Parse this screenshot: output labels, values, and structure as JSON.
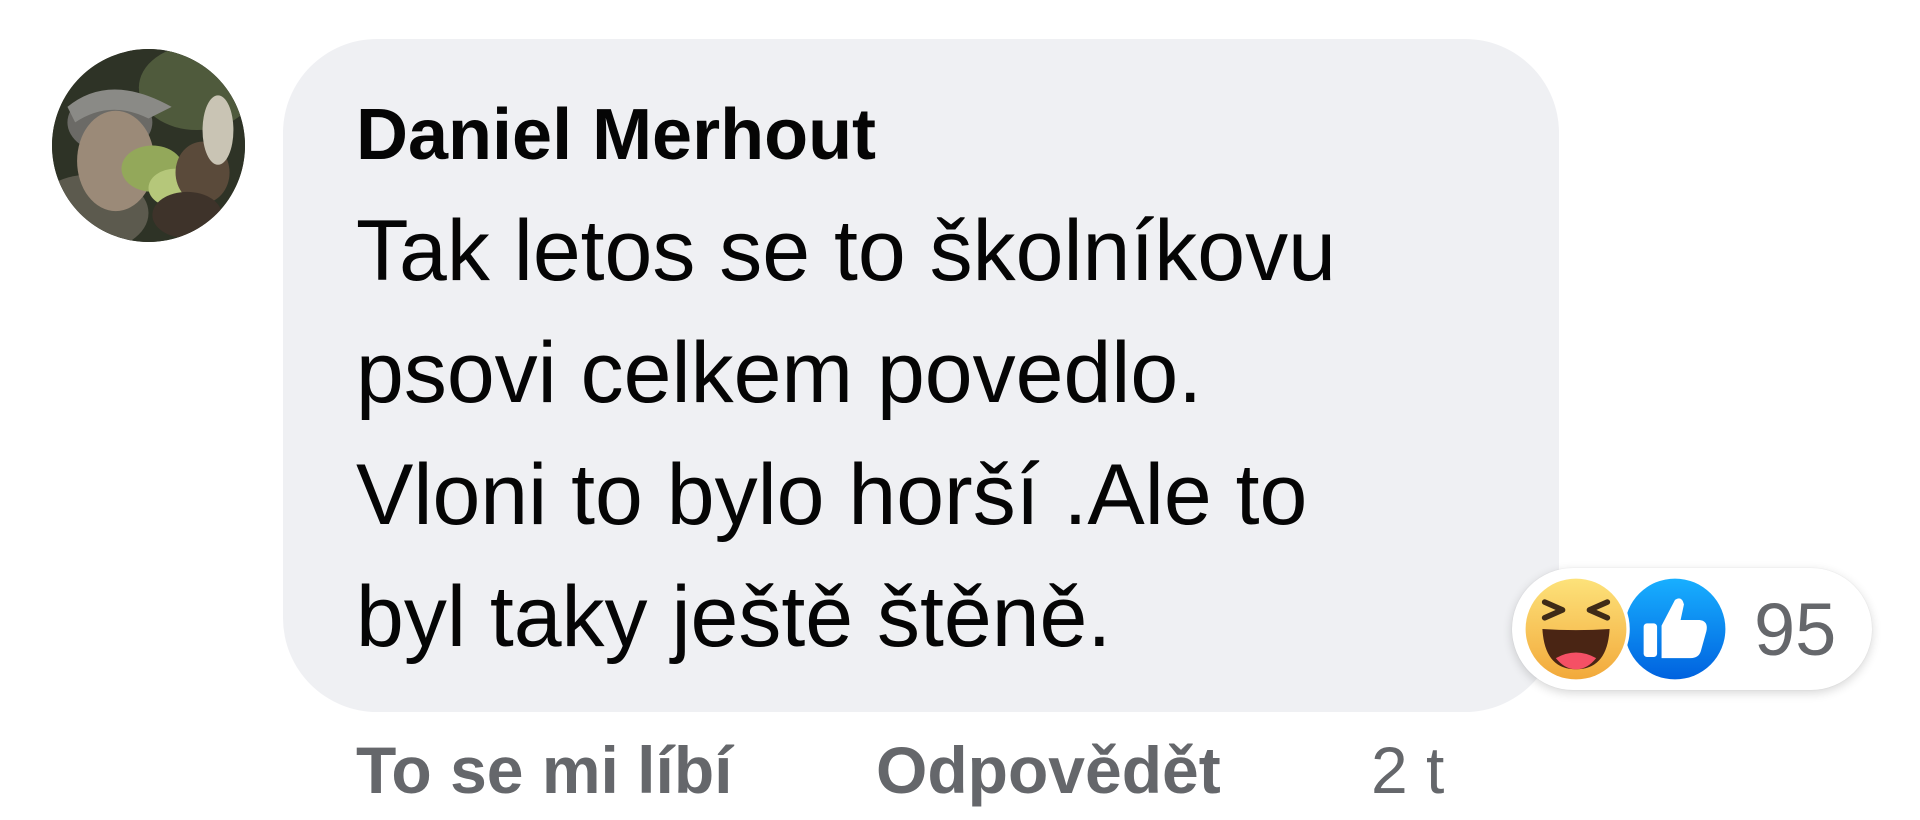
{
  "comment": {
    "author": "Daniel Merhout",
    "text_lines": [
      "Tak letos se to školníkovu",
      "psovi celkem povedlo.",
      "Vloni to bylo horší .Ale to",
      "byl taky ještě štěně."
    ],
    "reactions": {
      "icons": [
        "haha-emoji-icon",
        "like-thumb-icon"
      ],
      "count": "95"
    },
    "actions": {
      "like_label": "To se mi líbí",
      "reply_label": "Odpovědět",
      "timestamp": "2 t"
    }
  },
  "colors": {
    "bubble_background": "#eff0f3",
    "primary_text": "#050505",
    "secondary_text": "#65676b",
    "like_blue": "#1877f2",
    "haha_yellow": "#f7c340"
  }
}
